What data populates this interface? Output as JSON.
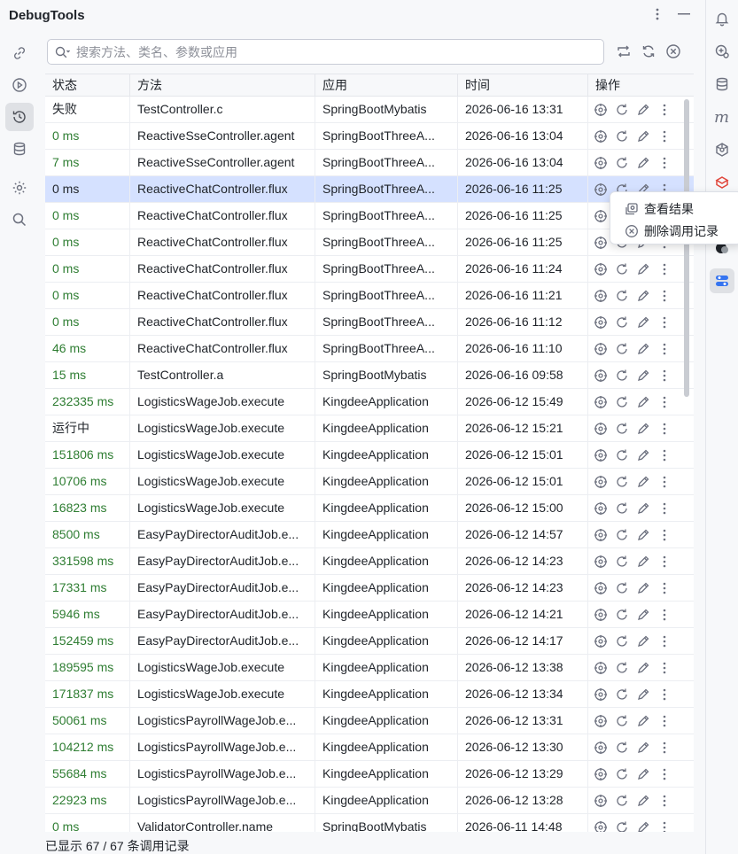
{
  "app": {
    "title": "DebugTools"
  },
  "left_rail": [
    {
      "icon": "link-icon"
    },
    {
      "icon": "play-circle-icon"
    },
    {
      "icon": "history-icon",
      "active": true
    },
    {
      "icon": "database-icon"
    },
    {
      "icon": "gear-icon"
    },
    {
      "icon": "search-icon"
    }
  ],
  "search": {
    "placeholder": "搜索方法、类名、参数或应用",
    "value": ""
  },
  "table": {
    "headers": {
      "status": "状态",
      "method": "方法",
      "app": "应用",
      "time": "时间",
      "ops": "操作"
    },
    "rows": [
      {
        "status": "失败",
        "status_color": "dark",
        "method": "TestController.c",
        "app": "SpringBootMybatis",
        "time": "2026-06-16 13:31"
      },
      {
        "status": "0 ms",
        "status_color": "green",
        "method": "ReactiveSseController.agent",
        "app": "SpringBootThreeA...",
        "time": "2026-06-16 13:04"
      },
      {
        "status": "7 ms",
        "status_color": "green",
        "method": "ReactiveSseController.agent",
        "app": "SpringBootThreeA...",
        "time": "2026-06-16 13:04"
      },
      {
        "status": "0 ms",
        "status_color": "dark",
        "method": "ReactiveChatController.flux",
        "app": "SpringBootThreeA...",
        "time": "2026-06-16 11:25",
        "selected": true
      },
      {
        "status": "0 ms",
        "status_color": "green",
        "method": "ReactiveChatController.flux",
        "app": "SpringBootThreeA...",
        "time": "2026-06-16 11:25"
      },
      {
        "status": "0 ms",
        "status_color": "green",
        "method": "ReactiveChatController.flux",
        "app": "SpringBootThreeA...",
        "time": "2026-06-16 11:25"
      },
      {
        "status": "0 ms",
        "status_color": "green",
        "method": "ReactiveChatController.flux",
        "app": "SpringBootThreeA...",
        "time": "2026-06-16 11:24"
      },
      {
        "status": "0 ms",
        "status_color": "green",
        "method": "ReactiveChatController.flux",
        "app": "SpringBootThreeA...",
        "time": "2026-06-16 11:21"
      },
      {
        "status": "0 ms",
        "status_color": "green",
        "method": "ReactiveChatController.flux",
        "app": "SpringBootThreeA...",
        "time": "2026-06-16 11:12"
      },
      {
        "status": "46 ms",
        "status_color": "green",
        "method": "ReactiveChatController.flux",
        "app": "SpringBootThreeA...",
        "time": "2026-06-16 11:10"
      },
      {
        "status": "15 ms",
        "status_color": "green",
        "method": "TestController.a",
        "app": "SpringBootMybatis",
        "time": "2026-06-16 09:58"
      },
      {
        "status": "232335 ms",
        "status_color": "green",
        "method": "LogisticsWageJob.execute",
        "app": "KingdeeApplication",
        "time": "2026-06-12 15:49"
      },
      {
        "status": "运行中",
        "status_color": "dark",
        "method": "LogisticsWageJob.execute",
        "app": "KingdeeApplication",
        "time": "2026-06-12 15:21"
      },
      {
        "status": "151806 ms",
        "status_color": "green",
        "method": "LogisticsWageJob.execute",
        "app": "KingdeeApplication",
        "time": "2026-06-12 15:01"
      },
      {
        "status": "10706 ms",
        "status_color": "green",
        "method": "LogisticsWageJob.execute",
        "app": "KingdeeApplication",
        "time": "2026-06-12 15:01"
      },
      {
        "status": "16823 ms",
        "status_color": "green",
        "method": "LogisticsWageJob.execute",
        "app": "KingdeeApplication",
        "time": "2026-06-12 15:00"
      },
      {
        "status": "8500 ms",
        "status_color": "green",
        "method": "EasyPayDirectorAuditJob.e...",
        "app": "KingdeeApplication",
        "time": "2026-06-12 14:57"
      },
      {
        "status": "331598 ms",
        "status_color": "green",
        "method": "EasyPayDirectorAuditJob.e...",
        "app": "KingdeeApplication",
        "time": "2026-06-12 14:23"
      },
      {
        "status": "17331 ms",
        "status_color": "green",
        "method": "EasyPayDirectorAuditJob.e...",
        "app": "KingdeeApplication",
        "time": "2026-06-12 14:23"
      },
      {
        "status": "5946 ms",
        "status_color": "green",
        "method": "EasyPayDirectorAuditJob.e...",
        "app": "KingdeeApplication",
        "time": "2026-06-12 14:21"
      },
      {
        "status": "152459 ms",
        "status_color": "green",
        "method": "EasyPayDirectorAuditJob.e...",
        "app": "KingdeeApplication",
        "time": "2026-06-12 14:17"
      },
      {
        "status": "189595 ms",
        "status_color": "green",
        "method": "LogisticsWageJob.execute",
        "app": "KingdeeApplication",
        "time": "2026-06-12 13:38"
      },
      {
        "status": "171837 ms",
        "status_color": "green",
        "method": "LogisticsWageJob.execute",
        "app": "KingdeeApplication",
        "time": "2026-06-12 13:34"
      },
      {
        "status": "50061 ms",
        "status_color": "green",
        "method": "LogisticsPayrollWageJob.e...",
        "app": "KingdeeApplication",
        "time": "2026-06-12 13:31"
      },
      {
        "status": "104212 ms",
        "status_color": "green",
        "method": "LogisticsPayrollWageJob.e...",
        "app": "KingdeeApplication",
        "time": "2026-06-12 13:30"
      },
      {
        "status": "55684 ms",
        "status_color": "green",
        "method": "LogisticsPayrollWageJob.e...",
        "app": "KingdeeApplication",
        "time": "2026-06-12 13:29"
      },
      {
        "status": "22923 ms",
        "status_color": "green",
        "method": "LogisticsPayrollWageJob.e...",
        "app": "KingdeeApplication",
        "time": "2026-06-12 13:28"
      },
      {
        "status": "0 ms",
        "status_color": "green",
        "method": "ValidatorController.name",
        "app": "SpringBootMybatis",
        "time": "2026-06-11 14:48"
      }
    ]
  },
  "context_menu": {
    "items": [
      {
        "label": "查看结果",
        "icon": "view-result-icon"
      },
      {
        "label": "删除调用记录",
        "icon": "delete-circle-icon"
      }
    ]
  },
  "footer": {
    "count_text": "已显示 67 / 67 条调用记录"
  },
  "colors": {
    "success": "#2e7d32",
    "selected_row": "#d5e1ff",
    "accent": "#3574f0"
  }
}
